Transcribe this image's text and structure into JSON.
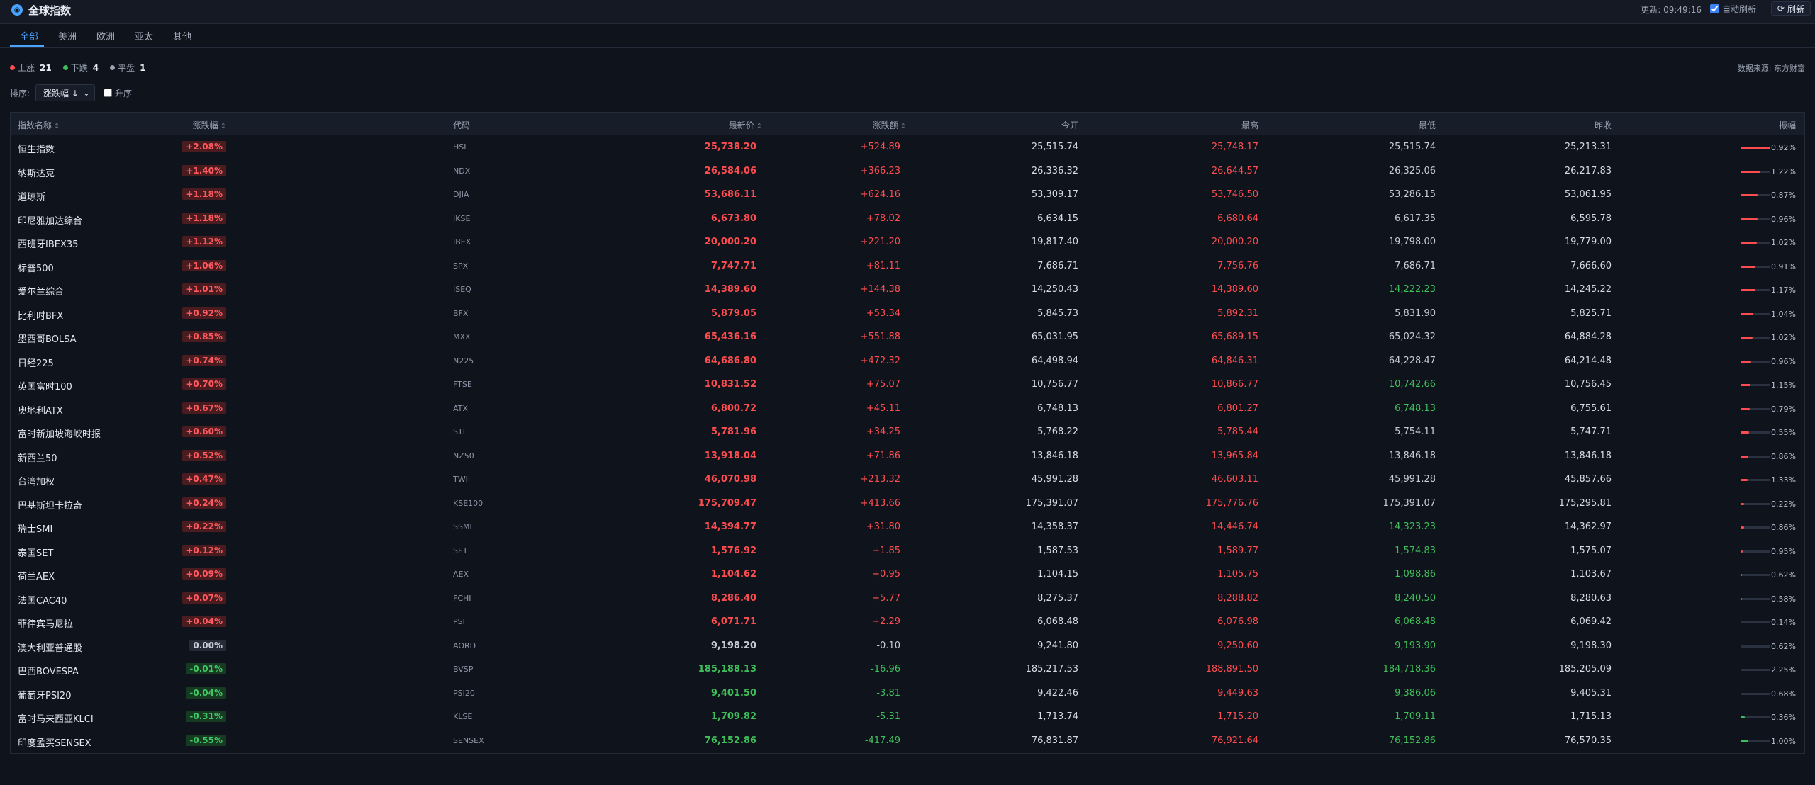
{
  "app": {
    "title": "全球指数",
    "logo_icon": "globe-icon"
  },
  "header": {
    "update_label": "更新: 09:49:16",
    "auto_refresh_label": "自动刷新",
    "auto_refresh_checked": true,
    "refresh_label": "刷新"
  },
  "tabs": [
    {
      "label": "全部",
      "active": true
    },
    {
      "label": "美洲"
    },
    {
      "label": "欧洲"
    },
    {
      "label": "亚太"
    },
    {
      "label": "其他"
    }
  ],
  "stats": {
    "up_label": "上涨",
    "up_count": "21",
    "down_label": "下跌",
    "down_count": "4",
    "flat_label": "平盘",
    "flat_count": "1"
  },
  "source": "数据来源: 东方财富",
  "sort": {
    "label": "排序:",
    "selected": "涨跌幅 ↓",
    "asc_label": "升序",
    "asc_checked": false
  },
  "colors": {
    "up": "#ff4d4f",
    "down": "#3fbf5a",
    "accent": "#4aa3ff"
  },
  "table": {
    "headers": {
      "name": "指数名称",
      "pct": "涨跌幅",
      "code": "代码",
      "price": "最新价",
      "chg": "涨跌额",
      "open": "今开",
      "high": "最高",
      "low": "最低",
      "prev": "昨收",
      "amp": "振幅"
    },
    "rows": [
      {
        "name": "恒生指数",
        "pct": "+2.08%",
        "code": "HSI",
        "price": "25,738.20",
        "chg": "+524.89",
        "open": "25,515.74",
        "high": "25,748.17",
        "low": "25,515.74",
        "prev": "25,213.31",
        "amp": "0.92%",
        "dir": "up",
        "high_dir": "up",
        "low_dir": "flat",
        "amp_fill": 1.0
      },
      {
        "name": "纳斯达克",
        "pct": "+1.40%",
        "code": "NDX",
        "price": "26,584.06",
        "chg": "+366.23",
        "open": "26,336.32",
        "high": "26,644.57",
        "low": "26,325.06",
        "prev": "26,217.83",
        "amp": "1.22%",
        "dir": "up",
        "high_dir": "up",
        "low_dir": "flat",
        "amp_fill": 0.67
      },
      {
        "name": "道琼斯",
        "pct": "+1.18%",
        "code": "DJIA",
        "price": "53,686.11",
        "chg": "+624.16",
        "open": "53,309.17",
        "high": "53,746.50",
        "low": "53,286.15",
        "prev": "53,061.95",
        "amp": "0.87%",
        "dir": "up",
        "high_dir": "up",
        "low_dir": "flat",
        "amp_fill": 0.57
      },
      {
        "name": "印尼雅加达综合",
        "pct": "+1.18%",
        "code": "JKSE",
        "price": "6,673.80",
        "chg": "+78.02",
        "open": "6,634.15",
        "high": "6,680.64",
        "low": "6,617.35",
        "prev": "6,595.78",
        "amp": "0.96%",
        "dir": "up",
        "high_dir": "up",
        "low_dir": "flat",
        "amp_fill": 0.57
      },
      {
        "name": "西班牙IBEX35",
        "pct": "+1.12%",
        "code": "IBEX",
        "price": "20,000.20",
        "chg": "+221.20",
        "open": "19,817.40",
        "high": "20,000.20",
        "low": "19,798.00",
        "prev": "19,779.00",
        "amp": "1.02%",
        "dir": "up",
        "high_dir": "up",
        "low_dir": "flat",
        "amp_fill": 0.54
      },
      {
        "name": "标普500",
        "pct": "+1.06%",
        "code": "SPX",
        "price": "7,747.71",
        "chg": "+81.11",
        "open": "7,686.71",
        "high": "7,756.76",
        "low": "7,686.71",
        "prev": "7,666.60",
        "amp": "0.91%",
        "dir": "up",
        "high_dir": "up",
        "low_dir": "flat",
        "amp_fill": 0.51
      },
      {
        "name": "爱尔兰综合",
        "pct": "+1.01%",
        "code": "ISEQ",
        "price": "14,389.60",
        "chg": "+144.38",
        "open": "14,250.43",
        "high": "14,389.60",
        "low": "14,222.23",
        "prev": "14,245.22",
        "amp": "1.17%",
        "dir": "up",
        "high_dir": "up",
        "low_dir": "down",
        "amp_fill": 0.49
      },
      {
        "name": "比利时BFX",
        "pct": "+0.92%",
        "code": "BFX",
        "price": "5,879.05",
        "chg": "+53.34",
        "open": "5,845.73",
        "high": "5,892.31",
        "low": "5,831.90",
        "prev": "5,825.71",
        "amp": "1.04%",
        "dir": "up",
        "high_dir": "up",
        "low_dir": "flat",
        "amp_fill": 0.44
      },
      {
        "name": "墨西哥BOLSA",
        "pct": "+0.85%",
        "code": "MXX",
        "price": "65,436.16",
        "chg": "+551.88",
        "open": "65,031.95",
        "high": "65,689.15",
        "low": "65,024.32",
        "prev": "64,884.28",
        "amp": "1.02%",
        "dir": "up",
        "high_dir": "up",
        "low_dir": "flat",
        "amp_fill": 0.41
      },
      {
        "name": "日经225",
        "pct": "+0.74%",
        "code": "N225",
        "price": "64,686.80",
        "chg": "+472.32",
        "open": "64,498.94",
        "high": "64,846.31",
        "low": "64,228.47",
        "prev": "64,214.48",
        "amp": "0.96%",
        "dir": "up",
        "high_dir": "up",
        "low_dir": "flat",
        "amp_fill": 0.36
      },
      {
        "name": "英国富时100",
        "pct": "+0.70%",
        "code": "FTSE",
        "price": "10,831.52",
        "chg": "+75.07",
        "open": "10,756.77",
        "high": "10,866.77",
        "low": "10,742.66",
        "prev": "10,756.45",
        "amp": "1.15%",
        "dir": "up",
        "high_dir": "up",
        "low_dir": "down",
        "amp_fill": 0.34
      },
      {
        "name": "奥地利ATX",
        "pct": "+0.67%",
        "code": "ATX",
        "price": "6,800.72",
        "chg": "+45.11",
        "open": "6,748.13",
        "high": "6,801.27",
        "low": "6,748.13",
        "prev": "6,755.61",
        "amp": "0.79%",
        "dir": "up",
        "high_dir": "up",
        "low_dir": "down",
        "amp_fill": 0.32
      },
      {
        "name": "富时新加坡海峡时报",
        "pct": "+0.60%",
        "code": "STI",
        "price": "5,781.96",
        "chg": "+34.25",
        "open": "5,768.22",
        "high": "5,785.44",
        "low": "5,754.11",
        "prev": "5,747.71",
        "amp": "0.55%",
        "dir": "up",
        "high_dir": "up",
        "low_dir": "flat",
        "amp_fill": 0.29
      },
      {
        "name": "新西兰50",
        "pct": "+0.52%",
        "code": "NZ50",
        "price": "13,918.04",
        "chg": "+71.86",
        "open": "13,846.18",
        "high": "13,965.84",
        "low": "13,846.18",
        "prev": "13,846.18",
        "amp": "0.86%",
        "dir": "up",
        "high_dir": "up",
        "low_dir": "flat",
        "amp_fill": 0.25
      },
      {
        "name": "台湾加权",
        "pct": "+0.47%",
        "code": "TWII",
        "price": "46,070.98",
        "chg": "+213.32",
        "open": "45,991.28",
        "high": "46,603.11",
        "low": "45,991.28",
        "prev": "45,857.66",
        "amp": "1.33%",
        "dir": "up",
        "high_dir": "up",
        "low_dir": "flat",
        "amp_fill": 0.23
      },
      {
        "name": "巴基斯坦卡拉奇",
        "pct": "+0.24%",
        "code": "KSE100",
        "price": "175,709.47",
        "chg": "+413.66",
        "open": "175,391.07",
        "high": "175,776.76",
        "low": "175,391.07",
        "prev": "175,295.81",
        "amp": "0.22%",
        "dir": "up",
        "high_dir": "up",
        "low_dir": "flat",
        "amp_fill": 0.12
      },
      {
        "name": "瑞士SMI",
        "pct": "+0.22%",
        "code": "SSMI",
        "price": "14,394.77",
        "chg": "+31.80",
        "open": "14,358.37",
        "high": "14,446.74",
        "low": "14,323.23",
        "prev": "14,362.97",
        "amp": "0.86%",
        "dir": "up",
        "high_dir": "up",
        "low_dir": "down",
        "amp_fill": 0.11
      },
      {
        "name": "泰国SET",
        "pct": "+0.12%",
        "code": "SET",
        "price": "1,576.92",
        "chg": "+1.85",
        "open": "1,587.53",
        "high": "1,589.77",
        "low": "1,574.83",
        "prev": "1,575.07",
        "amp": "0.95%",
        "dir": "up",
        "high_dir": "up",
        "low_dir": "down",
        "amp_fill": 0.06
      },
      {
        "name": "荷兰AEX",
        "pct": "+0.09%",
        "code": "AEX",
        "price": "1,104.62",
        "chg": "+0.95",
        "open": "1,104.15",
        "high": "1,105.75",
        "low": "1,098.86",
        "prev": "1,103.67",
        "amp": "0.62%",
        "dir": "up",
        "high_dir": "up",
        "low_dir": "down",
        "amp_fill": 0.05
      },
      {
        "name": "法国CAC40",
        "pct": "+0.07%",
        "code": "FCHI",
        "price": "8,286.40",
        "chg": "+5.77",
        "open": "8,275.37",
        "high": "8,288.82",
        "low": "8,240.50",
        "prev": "8,280.63",
        "amp": "0.58%",
        "dir": "up",
        "high_dir": "up",
        "low_dir": "down",
        "amp_fill": 0.04
      },
      {
        "name": "菲律宾马尼拉",
        "pct": "+0.04%",
        "code": "PSI",
        "price": "6,071.71",
        "chg": "+2.29",
        "open": "6,068.48",
        "high": "6,076.98",
        "low": "6,068.48",
        "prev": "6,069.42",
        "amp": "0.14%",
        "dir": "up",
        "high_dir": "up",
        "low_dir": "down",
        "amp_fill": 0.02
      },
      {
        "name": "澳大利亚普通股",
        "pct": "0.00%",
        "code": "AORD",
        "price": "9,198.20",
        "chg": "-0.10",
        "open": "9,241.80",
        "high": "9,250.60",
        "low": "9,193.90",
        "prev": "9,198.30",
        "amp": "0.62%",
        "dir": "flat",
        "high_dir": "up",
        "low_dir": "down",
        "amp_fill": 0.0
      },
      {
        "name": "巴西BOVESPA",
        "pct": "-0.01%",
        "code": "BVSP",
        "price": "185,188.13",
        "chg": "-16.96",
        "open": "185,217.53",
        "high": "188,891.50",
        "low": "184,718.36",
        "prev": "185,205.09",
        "amp": "2.25%",
        "dir": "down",
        "high_dir": "up",
        "low_dir": "down",
        "amp_fill": 0.01
      },
      {
        "name": "葡萄牙PSI20",
        "pct": "-0.04%",
        "code": "PSI20",
        "price": "9,401.50",
        "chg": "-3.81",
        "open": "9,422.46",
        "high": "9,449.63",
        "low": "9,386.06",
        "prev": "9,405.31",
        "amp": "0.68%",
        "dir": "down",
        "high_dir": "up",
        "low_dir": "down",
        "amp_fill": 0.02
      },
      {
        "name": "富时马来西亚KLCI",
        "pct": "-0.31%",
        "code": "KLSE",
        "price": "1,709.82",
        "chg": "-5.31",
        "open": "1,713.74",
        "high": "1,715.20",
        "low": "1,709.11",
        "prev": "1,715.13",
        "amp": "0.36%",
        "dir": "down",
        "high_dir": "up",
        "low_dir": "down",
        "amp_fill": 0.15
      },
      {
        "name": "印度孟买SENSEX",
        "pct": "-0.55%",
        "code": "SENSEX",
        "price": "76,152.86",
        "chg": "-417.49",
        "open": "76,831.87",
        "high": "76,921.64",
        "low": "76,152.86",
        "prev": "76,570.35",
        "amp": "1.00%",
        "dir": "down",
        "high_dir": "up",
        "low_dir": "down",
        "amp_fill": 0.26
      }
    ]
  }
}
